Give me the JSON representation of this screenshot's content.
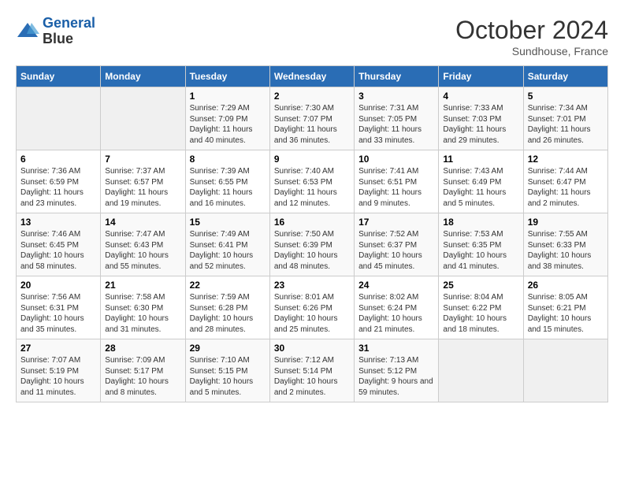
{
  "logo": {
    "line1": "General",
    "line2": "Blue"
  },
  "title": "October 2024",
  "location": "Sundhouse, France",
  "days_header": [
    "Sunday",
    "Monday",
    "Tuesday",
    "Wednesday",
    "Thursday",
    "Friday",
    "Saturday"
  ],
  "weeks": [
    [
      {
        "day": "",
        "info": ""
      },
      {
        "day": "",
        "info": ""
      },
      {
        "day": "1",
        "info": "Sunrise: 7:29 AM\nSunset: 7:09 PM\nDaylight: 11 hours and 40 minutes."
      },
      {
        "day": "2",
        "info": "Sunrise: 7:30 AM\nSunset: 7:07 PM\nDaylight: 11 hours and 36 minutes."
      },
      {
        "day": "3",
        "info": "Sunrise: 7:31 AM\nSunset: 7:05 PM\nDaylight: 11 hours and 33 minutes."
      },
      {
        "day": "4",
        "info": "Sunrise: 7:33 AM\nSunset: 7:03 PM\nDaylight: 11 hours and 29 minutes."
      },
      {
        "day": "5",
        "info": "Sunrise: 7:34 AM\nSunset: 7:01 PM\nDaylight: 11 hours and 26 minutes."
      }
    ],
    [
      {
        "day": "6",
        "info": "Sunrise: 7:36 AM\nSunset: 6:59 PM\nDaylight: 11 hours and 23 minutes."
      },
      {
        "day": "7",
        "info": "Sunrise: 7:37 AM\nSunset: 6:57 PM\nDaylight: 11 hours and 19 minutes."
      },
      {
        "day": "8",
        "info": "Sunrise: 7:39 AM\nSunset: 6:55 PM\nDaylight: 11 hours and 16 minutes."
      },
      {
        "day": "9",
        "info": "Sunrise: 7:40 AM\nSunset: 6:53 PM\nDaylight: 11 hours and 12 minutes."
      },
      {
        "day": "10",
        "info": "Sunrise: 7:41 AM\nSunset: 6:51 PM\nDaylight: 11 hours and 9 minutes."
      },
      {
        "day": "11",
        "info": "Sunrise: 7:43 AM\nSunset: 6:49 PM\nDaylight: 11 hours and 5 minutes."
      },
      {
        "day": "12",
        "info": "Sunrise: 7:44 AM\nSunset: 6:47 PM\nDaylight: 11 hours and 2 minutes."
      }
    ],
    [
      {
        "day": "13",
        "info": "Sunrise: 7:46 AM\nSunset: 6:45 PM\nDaylight: 10 hours and 58 minutes."
      },
      {
        "day": "14",
        "info": "Sunrise: 7:47 AM\nSunset: 6:43 PM\nDaylight: 10 hours and 55 minutes."
      },
      {
        "day": "15",
        "info": "Sunrise: 7:49 AM\nSunset: 6:41 PM\nDaylight: 10 hours and 52 minutes."
      },
      {
        "day": "16",
        "info": "Sunrise: 7:50 AM\nSunset: 6:39 PM\nDaylight: 10 hours and 48 minutes."
      },
      {
        "day": "17",
        "info": "Sunrise: 7:52 AM\nSunset: 6:37 PM\nDaylight: 10 hours and 45 minutes."
      },
      {
        "day": "18",
        "info": "Sunrise: 7:53 AM\nSunset: 6:35 PM\nDaylight: 10 hours and 41 minutes."
      },
      {
        "day": "19",
        "info": "Sunrise: 7:55 AM\nSunset: 6:33 PM\nDaylight: 10 hours and 38 minutes."
      }
    ],
    [
      {
        "day": "20",
        "info": "Sunrise: 7:56 AM\nSunset: 6:31 PM\nDaylight: 10 hours and 35 minutes."
      },
      {
        "day": "21",
        "info": "Sunrise: 7:58 AM\nSunset: 6:30 PM\nDaylight: 10 hours and 31 minutes."
      },
      {
        "day": "22",
        "info": "Sunrise: 7:59 AM\nSunset: 6:28 PM\nDaylight: 10 hours and 28 minutes."
      },
      {
        "day": "23",
        "info": "Sunrise: 8:01 AM\nSunset: 6:26 PM\nDaylight: 10 hours and 25 minutes."
      },
      {
        "day": "24",
        "info": "Sunrise: 8:02 AM\nSunset: 6:24 PM\nDaylight: 10 hours and 21 minutes."
      },
      {
        "day": "25",
        "info": "Sunrise: 8:04 AM\nSunset: 6:22 PM\nDaylight: 10 hours and 18 minutes."
      },
      {
        "day": "26",
        "info": "Sunrise: 8:05 AM\nSunset: 6:21 PM\nDaylight: 10 hours and 15 minutes."
      }
    ],
    [
      {
        "day": "27",
        "info": "Sunrise: 7:07 AM\nSunset: 5:19 PM\nDaylight: 10 hours and 11 minutes."
      },
      {
        "day": "28",
        "info": "Sunrise: 7:09 AM\nSunset: 5:17 PM\nDaylight: 10 hours and 8 minutes."
      },
      {
        "day": "29",
        "info": "Sunrise: 7:10 AM\nSunset: 5:15 PM\nDaylight: 10 hours and 5 minutes."
      },
      {
        "day": "30",
        "info": "Sunrise: 7:12 AM\nSunset: 5:14 PM\nDaylight: 10 hours and 2 minutes."
      },
      {
        "day": "31",
        "info": "Sunrise: 7:13 AM\nSunset: 5:12 PM\nDaylight: 9 hours and 59 minutes."
      },
      {
        "day": "",
        "info": ""
      },
      {
        "day": "",
        "info": ""
      }
    ]
  ]
}
